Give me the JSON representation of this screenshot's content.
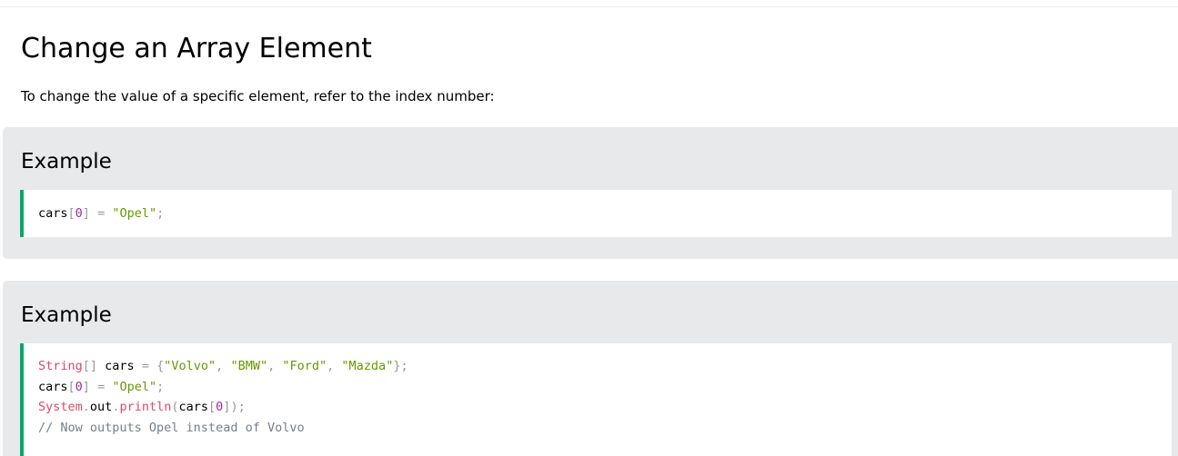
{
  "page": {
    "title": "Change an Array Element",
    "intro": "To change the value of a specific element, refer to the index number:"
  },
  "examples": [
    {
      "heading": "Example",
      "lines": [
        [
          {
            "t": "cars",
            "k": "ident"
          },
          {
            "t": "[",
            "k": "punct"
          },
          {
            "t": "0",
            "k": "number"
          },
          {
            "t": "]",
            "k": "punct"
          },
          {
            "t": " ",
            "k": "ident"
          },
          {
            "t": "=",
            "k": "punct"
          },
          {
            "t": " ",
            "k": "ident"
          },
          {
            "t": "\"Opel\"",
            "k": "string"
          },
          {
            "t": ";",
            "k": "punct"
          }
        ]
      ]
    },
    {
      "heading": "Example",
      "lines": [
        [
          {
            "t": "String",
            "k": "type"
          },
          {
            "t": "[]",
            "k": "punct"
          },
          {
            "t": " cars ",
            "k": "ident"
          },
          {
            "t": "=",
            "k": "punct"
          },
          {
            "t": " ",
            "k": "ident"
          },
          {
            "t": "{",
            "k": "punct"
          },
          {
            "t": "\"Volvo\"",
            "k": "string"
          },
          {
            "t": ",",
            "k": "punct"
          },
          {
            "t": " ",
            "k": "ident"
          },
          {
            "t": "\"BMW\"",
            "k": "string"
          },
          {
            "t": ",",
            "k": "punct"
          },
          {
            "t": " ",
            "k": "ident"
          },
          {
            "t": "\"Ford\"",
            "k": "string"
          },
          {
            "t": ",",
            "k": "punct"
          },
          {
            "t": " ",
            "k": "ident"
          },
          {
            "t": "\"Mazda\"",
            "k": "string"
          },
          {
            "t": "};",
            "k": "punct"
          }
        ],
        [
          {
            "t": "cars",
            "k": "ident"
          },
          {
            "t": "[",
            "k": "punct"
          },
          {
            "t": "0",
            "k": "number"
          },
          {
            "t": "]",
            "k": "punct"
          },
          {
            "t": " ",
            "k": "ident"
          },
          {
            "t": "=",
            "k": "punct"
          },
          {
            "t": " ",
            "k": "ident"
          },
          {
            "t": "\"Opel\"",
            "k": "string"
          },
          {
            "t": ";",
            "k": "punct"
          }
        ],
        [
          {
            "t": "System",
            "k": "type"
          },
          {
            "t": ".",
            "k": "punct"
          },
          {
            "t": "out",
            "k": "member"
          },
          {
            "t": ".",
            "k": "punct"
          },
          {
            "t": "println",
            "k": "method"
          },
          {
            "t": "(",
            "k": "punct"
          },
          {
            "t": "cars",
            "k": "ident"
          },
          {
            "t": "[",
            "k": "punct"
          },
          {
            "t": "0",
            "k": "number"
          },
          {
            "t": "]",
            "k": "punct"
          },
          {
            "t": ")",
            "k": "punct"
          },
          {
            "t": ";",
            "k": "punct"
          }
        ],
        [
          {
            "t": "// Now outputs Opel instead of Volvo",
            "k": "comment"
          }
        ]
      ]
    }
  ],
  "colors": {
    "example_background": "#e7e9eb",
    "code_accent_border": "#04aa6d",
    "string": "#669900",
    "number": "#a626a4",
    "keyword_type": "#dd4a68",
    "punctuation": "#999999",
    "comment": "#708090"
  }
}
